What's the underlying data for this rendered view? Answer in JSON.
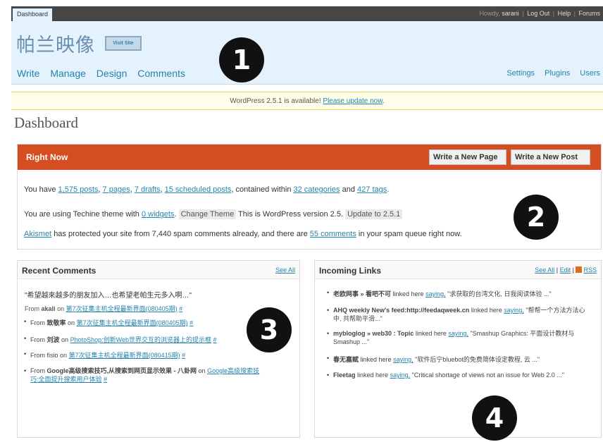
{
  "topbar": {
    "tab": "Dashboard",
    "howdy_prefix": "Howdy,",
    "user": "sarani",
    "links": [
      "Log Out",
      "Help",
      "Forums"
    ]
  },
  "header": {
    "site_title": "帕兰映像",
    "visit_site": "Visit Site",
    "nav": [
      "Write",
      "Manage",
      "Design",
      "Comments"
    ],
    "secondary_nav": [
      "Settings",
      "Plugins",
      "Users"
    ]
  },
  "update_nag": {
    "text": "WordPress 2.5.1 is available!",
    "link": "Please update now",
    "end": "."
  },
  "page_title": "Dashboard",
  "right_now": {
    "title": "Right Now",
    "btn_page": "Write a New Page",
    "btn_post": "Write a New Post",
    "you_have": "You have",
    "posts": "1,575 posts",
    "pages": "7 pages",
    "drafts": "7 drafts",
    "scheduled": "15 scheduled posts",
    "contained": ", contained within",
    "categories": "32 categories",
    "and": "and",
    "tags": "427 tags",
    "period": ".",
    "theme_prefix": "You are using Techine theme with",
    "widgets": "0 widgets",
    "change_theme": "Change Theme",
    "version_text": "This is WordPress version 2.5.",
    "update_btn": "Update to 2.5.1",
    "akismet": "Akismet",
    "akismet_text": "has protected your site from 7,440 spam comments already, and there are",
    "spam_comments": "55 comments",
    "spam_end": "in your spam queue right now."
  },
  "recent_comments": {
    "title": "Recent Comments",
    "see_all": "See All",
    "quote": "\"希望越來越多的朋友加入…也希望老帕生元多入啊…\"",
    "from_label": "From",
    "from_author": "akali",
    "on_label": "on",
    "from_post": "第7次征集主机全程最新界面(080405期)",
    "hash": "#",
    "items": [
      {
        "from": "From",
        "author": "致敬率",
        "on": "on",
        "post": "第7次征集主机全程最新界面(080405期)",
        "hash": "#"
      },
      {
        "from": "From",
        "author": "刘波",
        "on": "on",
        "post": "PhotoShop:创新Web世界交互的浏览器上的提示框",
        "hash": "#"
      },
      {
        "from": "From",
        "author": "fisio",
        "on": "on",
        "post": "第7次征集主机全程最新界面(080415期)",
        "hash": "#"
      },
      {
        "from": "From",
        "author": "Google高级搜索技巧,从搜索到网页显示效果 - 八卦网",
        "on": "on",
        "post": "Google高级搜索技巧:全面提升搜索用户体验",
        "hash": "#"
      }
    ]
  },
  "incoming_links": {
    "title": "Incoming Links",
    "see_all": "See All",
    "edit": "Edit",
    "rss": "RSS",
    "items": [
      {
        "source": "老欧网事 » 看吧不可",
        "linked": "linked here",
        "saying": "saying,",
        "quote": "\"求获取的台湾文化, 日我阅读体验 ...\""
      },
      {
        "source": "AHQ weekly New's feed:http://feedaqweek.cn",
        "linked": "linked here",
        "saying": "saying,",
        "quote": "\"帮帮一个方法方法心中, 共帮助平滑...\""
      },
      {
        "source": "mybloglog » web30 : Topic",
        "linked": "linked here",
        "saying": "saying,",
        "quote": "\"Smashup Graphics: 平面设计教材与Smashup ...\""
      },
      {
        "source": "春无嘉赋",
        "linked": "linked here",
        "saying": "saying,",
        "quote": "\"软件后宁bluebot的免费简体设定教程, 云 ...\""
      },
      {
        "source": "Fleetag",
        "linked": "linked here",
        "saying": "saying,",
        "quote": "\"Critical shortage of views not an issue for Web 2.0 ...\""
      }
    ]
  },
  "markers": [
    "1",
    "2",
    "3",
    "4"
  ],
  "colors": {
    "header_bg": "#e4f2fd",
    "right_now_bar": "#d54e21",
    "link": "#2583ad",
    "topbar": "#464646"
  }
}
